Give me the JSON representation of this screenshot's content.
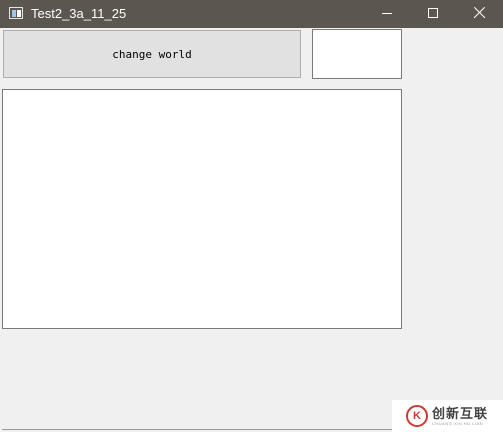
{
  "window": {
    "title": "Test2_3a_11_25",
    "icon": "app-window-icon",
    "controls": {
      "minimize_icon": "minimize-icon",
      "maximize_icon": "maximize-icon",
      "close_icon": "close-icon"
    }
  },
  "main": {
    "button_label": "change world",
    "line_edit_value": "",
    "text_area_value": ""
  },
  "watermark": {
    "logo_glyph": "K",
    "title": "创新互联",
    "subtitle": "CHUANG XIN HU LIAN"
  },
  "colors": {
    "titlebar": "#5c5650",
    "background": "#f0f0f0",
    "button_face": "#e1e1e1"
  }
}
